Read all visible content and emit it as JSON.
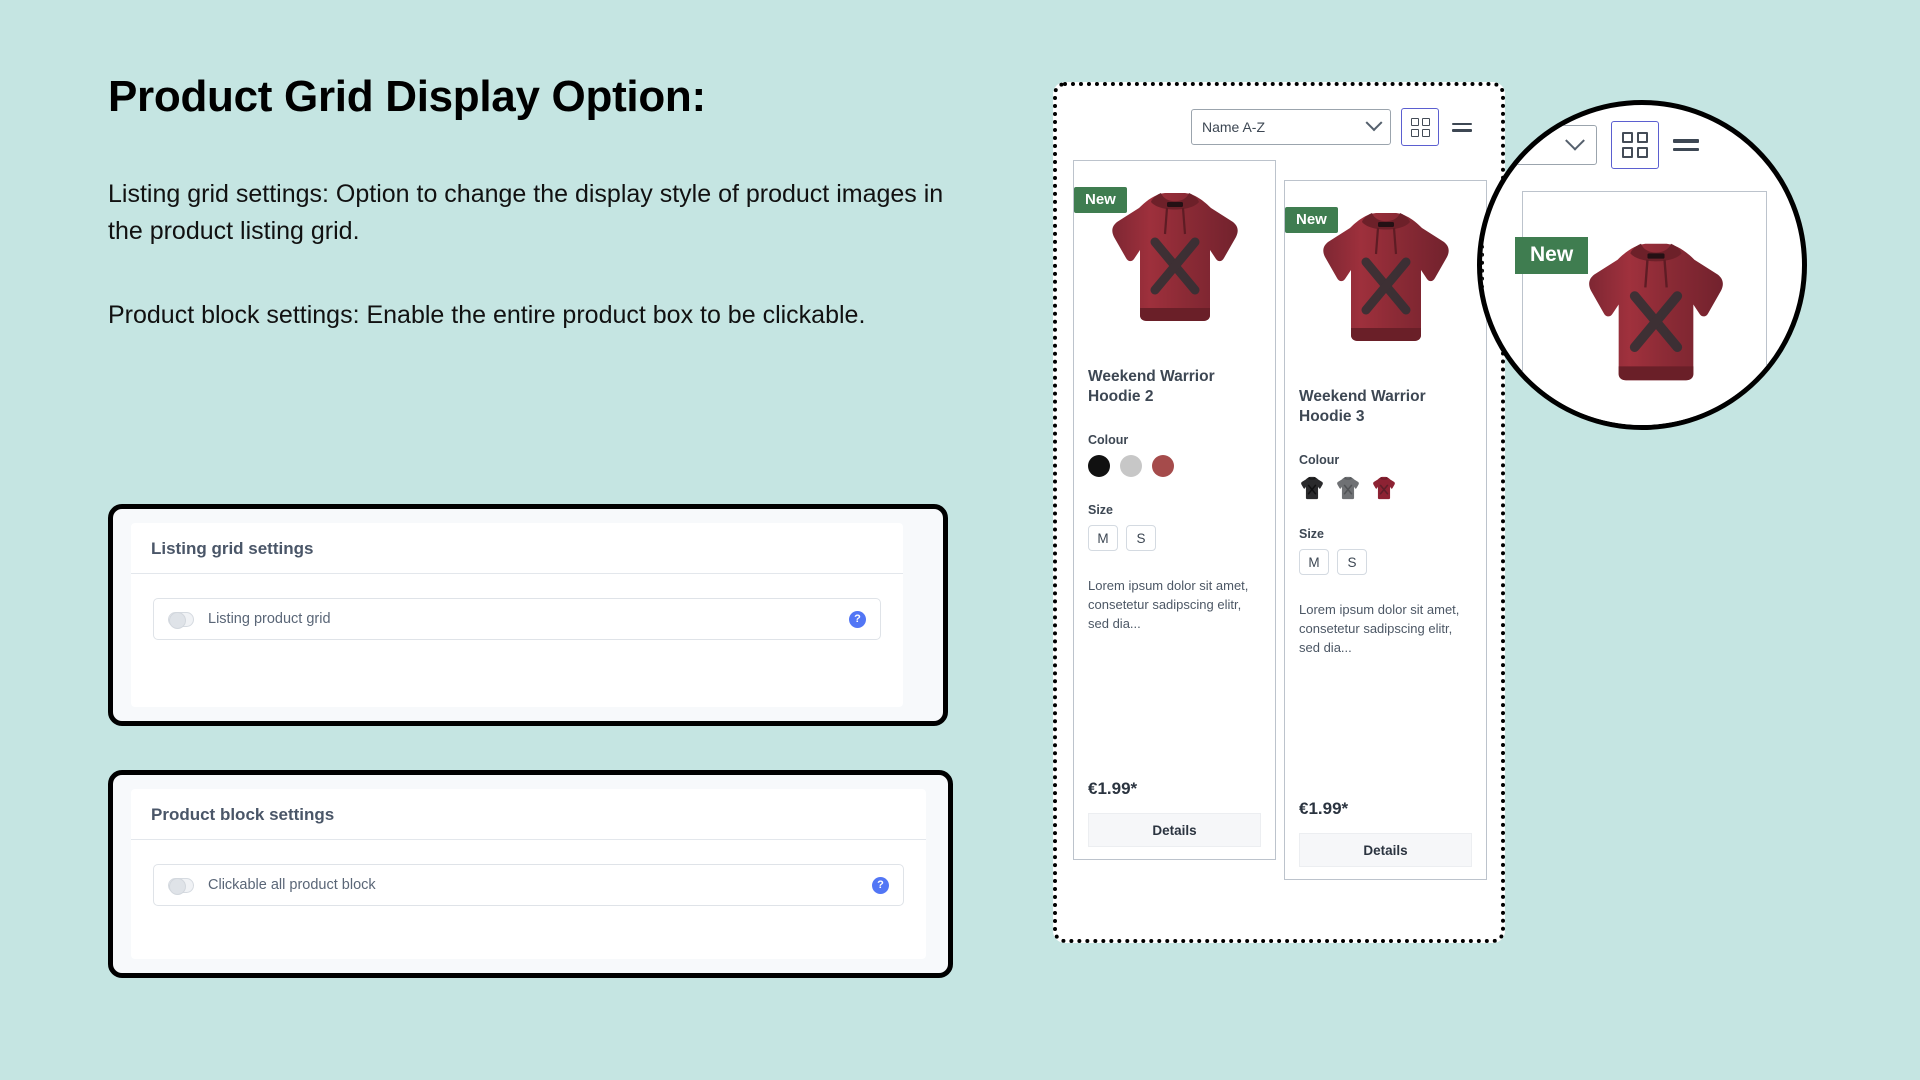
{
  "page": {
    "background_color": "#c5e5e2",
    "title": "Product Grid Display Option:",
    "paragraph_1": "Listing grid settings: Option to change the display style of product images in the product listing grid.",
    "paragraph_2": "Product block settings: Enable the entire product box to be clickable."
  },
  "settings": {
    "cards": [
      {
        "header": "Listing grid settings",
        "toggle_label": "Listing product grid",
        "toggle_state": "off",
        "help_icon": "question-mark-icon",
        "help_glyph": "?"
      },
      {
        "header": "Product block settings",
        "toggle_label": "Clickable all product block",
        "toggle_state": "off",
        "help_icon": "question-mark-icon",
        "help_glyph": "?"
      }
    ],
    "accent_color": "#5276f5"
  },
  "storefront": {
    "toolbar": {
      "sort_value": "Name A-Z",
      "grid_view_icon": "grid-view-icon",
      "list_view_icon": "list-view-icon",
      "grid_view_active": true,
      "active_border_color": "#5b5fd0"
    },
    "products": [
      {
        "badge": "New",
        "badge_color": "#3f7d50",
        "name": "Weekend Warrior Hoodie 2",
        "colour_label": "Colour",
        "colour_style": "swatch",
        "colours": [
          "#111111",
          "#c7c7c7",
          "#a54b4b"
        ],
        "size_label": "Size",
        "sizes": [
          "M",
          "S"
        ],
        "description": "Lorem ipsum dolor sit amet, consetetur sadipscing elitr, sed dia...",
        "price": "€1.99*",
        "details_label": "Details"
      },
      {
        "badge": "New",
        "badge_color": "#3f7d50",
        "name": "Weekend Warrior Hoodie 3",
        "colour_label": "Colour",
        "colour_style": "image",
        "colours": [
          "#2a2a2c",
          "#6f7174",
          "#8d2233"
        ],
        "size_label": "Size",
        "sizes": [
          "M",
          "S"
        ],
        "description": "Lorem ipsum dolor sit amet, consetetur sadipscing elitr, sed dia...",
        "price": "€1.99*",
        "details_label": "Details"
      }
    ]
  },
  "magnifier": {
    "name": "zoom-lens",
    "badge": "New",
    "grid_view_active": true
  }
}
